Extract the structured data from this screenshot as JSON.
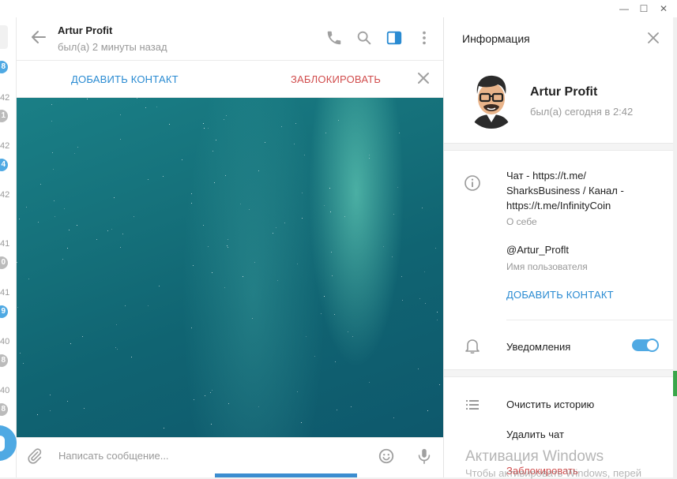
{
  "window": {
    "controls": {
      "minimize": "—",
      "maximize": "☐",
      "close": "✕"
    }
  },
  "chat_list_edge": {
    "rows": [
      {
        "time": "",
        "badge": "8",
        "badge_color": "#4fa9e3"
      },
      {
        "time": "42",
        "badge": "1",
        "badge_color": "#bbbbbb"
      },
      {
        "time": "42",
        "badge": "4",
        "badge_color": "#4fa9e3"
      },
      {
        "time": "42",
        "badge": "",
        "badge_color": ""
      },
      {
        "time": "41",
        "badge": "0",
        "badge_color": "#bbbbbb"
      },
      {
        "time": "41",
        "badge": "9",
        "badge_color": "#4fa9e3"
      },
      {
        "time": "40",
        "badge": "8",
        "badge_color": "#bbbbbb"
      },
      {
        "time": "40",
        "badge": "8",
        "badge_color": "#bbbbbb"
      }
    ]
  },
  "chat": {
    "name": "Artur Profit",
    "status": "был(а) 2 минуты назад",
    "actions": {
      "add_contact": "ДОБАВИТЬ КОНТАКТ",
      "block": "ЗАБЛОКИРОВАТЬ"
    },
    "composer": {
      "placeholder": "Написать сообщение..."
    },
    "icons": [
      "back-arrow-icon",
      "phone-icon",
      "search-icon",
      "sidebar-panel-icon",
      "more-vertical-icon",
      "close-icon",
      "paperclip-icon",
      "emoji-icon",
      "microphone-icon"
    ]
  },
  "info_panel": {
    "title": "Информация",
    "profile": {
      "name": "Artur Profit",
      "status": "был(а) сегодня в 2:42"
    },
    "bio": {
      "text": "Чат - https://t.me/ SharksBusiness / Канал - https://t.me/InfinityCoin",
      "caption": "О себе"
    },
    "username": {
      "value": "@Artur_Proflt",
      "caption": "Имя пользователя"
    },
    "add_contact": "ДОБАВИТЬ КОНТАКТ",
    "notifications": {
      "label": "Уведомления",
      "enabled": true
    },
    "menu": {
      "clear_history": "Очистить историю",
      "delete_chat": "Удалить чат",
      "block": "Заблокировать"
    }
  },
  "watermark": {
    "line1": "Активация Windows",
    "line2": "Чтобы активировать Windows, перей"
  },
  "colors": {
    "accent": "#4fa9e3",
    "link": "#2a8bd2",
    "danger": "#d14d4d"
  }
}
